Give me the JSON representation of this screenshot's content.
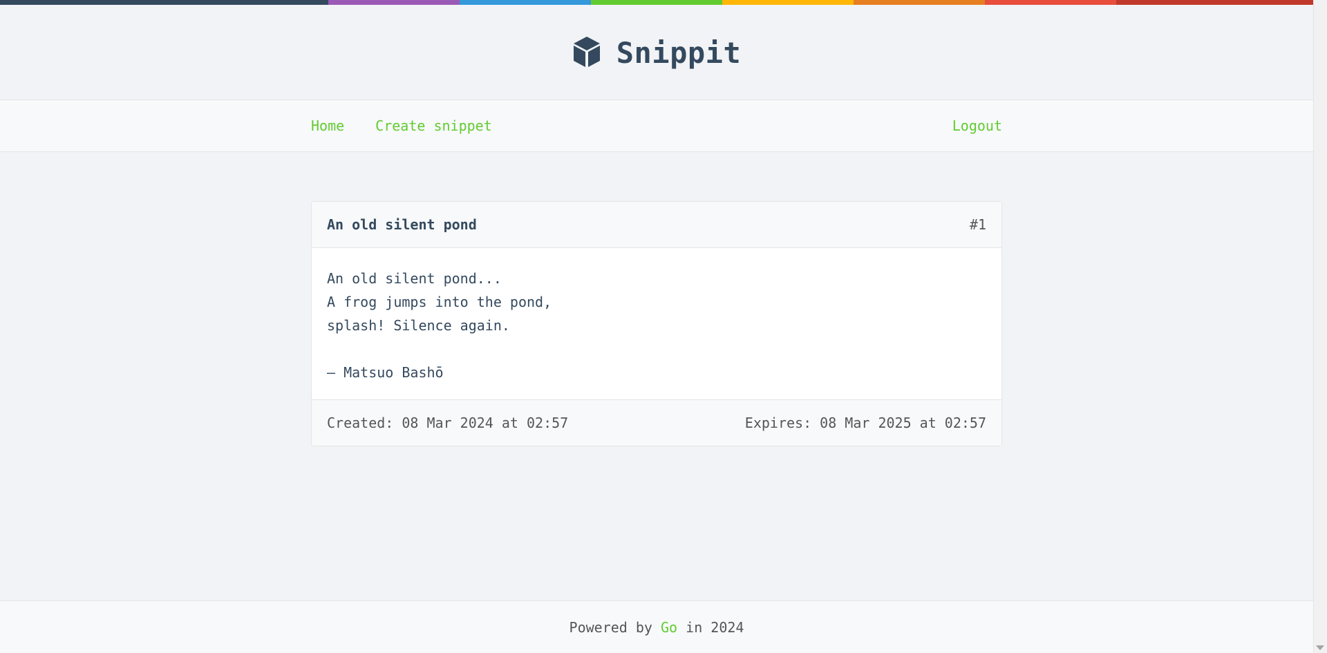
{
  "brand": {
    "title": "Snippit",
    "stripe_colors": [
      "#34495e",
      "#9b59b6",
      "#3498db",
      "#62cb31",
      "#ffb606",
      "#e67e22",
      "#e74c3c",
      "#c0392b"
    ]
  },
  "nav": {
    "home": "Home",
    "create": "Create snippet",
    "logout": "Logout",
    "link_color": "#62cb31"
  },
  "snippet": {
    "title": "An old silent pond",
    "id": "#1",
    "content": "An old silent pond...\nA frog jumps into the pond,\nsplash! Silence again.\n\n– Matsuo Bashō",
    "created": "Created: 08 Mar 2024 at 02:57",
    "expires": "Expires: 08 Mar 2025 at 02:57"
  },
  "footer": {
    "prefix": "Powered by",
    "link": "Go",
    "suffix": "in 2024"
  }
}
